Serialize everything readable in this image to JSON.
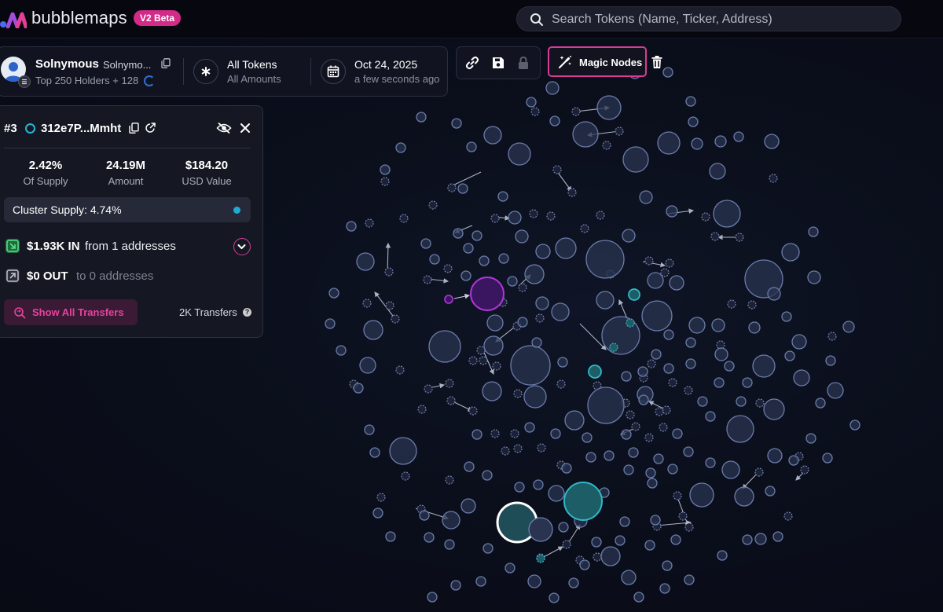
{
  "app": {
    "brand": "bubblemaps",
    "badge": "V2 Beta",
    "brand_colors": [
      "#4a6cf7",
      "#c13fd6",
      "#e43f96"
    ]
  },
  "search": {
    "placeholder": "Search Tokens (Name, Ticker, Address)"
  },
  "token": {
    "name": "Solnymous",
    "subname": "Solnymo...",
    "holders_info": "Top 250 Holders + 128",
    "tokens_title": "All Tokens",
    "tokens_sub": "All Amounts",
    "date_title": "Oct 24, 2025",
    "date_sub": "a few seconds ago"
  },
  "toolbar": {
    "link_icon": "link-icon",
    "save_icon": "save-icon",
    "lock_icon": "lock-icon",
    "magic_label": "Magic Nodes",
    "trash_icon": "trash-icon"
  },
  "wallet": {
    "rank": "#3",
    "address": "312e7P...Mmht",
    "stats": [
      {
        "value": "2.42%",
        "label": "Of Supply"
      },
      {
        "value": "24.19M",
        "label": "Amount"
      },
      {
        "value": "$184.20",
        "label": "USD Value"
      }
    ],
    "cluster_supply": "Cluster Supply: 4.74%",
    "transfers_in": {
      "value": "$1.93K IN",
      "text": "from 1 addresses"
    },
    "transfers_out": {
      "value": "$0 OUT",
      "text": "to 0 addresses"
    },
    "show_all_label": "Show All Transfers",
    "transfer_count": "2K Transfers",
    "help_icon": "?"
  },
  "colors": {
    "accent_pink": "#d63d96",
    "accent_teal": "#27b5d3",
    "bubble_fill": "#2a3450",
    "bubble_stroke": "#6b7cab",
    "selected_purple": "#b137d8",
    "cluster_teal": "#2fb8c9"
  }
}
